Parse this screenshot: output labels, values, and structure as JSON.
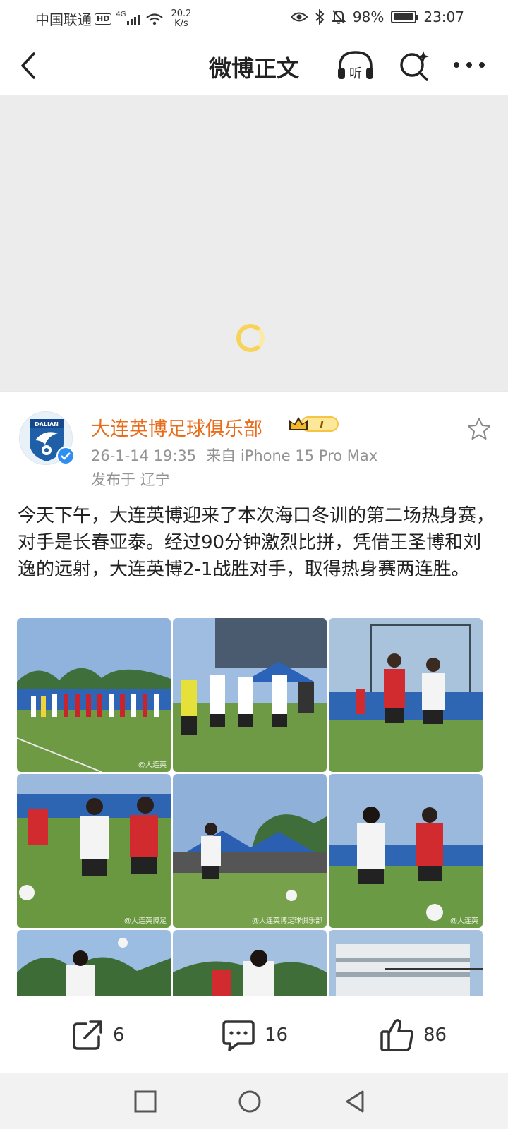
{
  "status_bar": {
    "carrier": "中国联通",
    "hd": "HD",
    "network": "4G",
    "speed_value": "20.2",
    "speed_unit": "K/s",
    "battery": "98%",
    "battery_level": 0.98,
    "time": "23:07"
  },
  "nav": {
    "title": "微博正文",
    "listen_label": "听"
  },
  "post": {
    "author": "大连英博足球俱乐部",
    "avatar_text": "DALIAN",
    "badge_text": "I",
    "date": "26-1-14 19:35",
    "source": "来自 iPhone 15 Pro Max",
    "location": "发布于 辽宁",
    "text": "今天下午，大连英博迎来了本次海口冬训的第二场热身赛，对手是长春亚泰。经过90分钟激烈比拼，凭借王圣博和刘逸的远射，大连英博2-1战胜对手，取得热身赛两连胜。",
    "watermarks": [
      "@大连英",
      "",
      "",
      "@大连英博足",
      "@大连英博足球俱乐部",
      "@大连英"
    ]
  },
  "actions": {
    "share_count": "6",
    "comment_count": "16",
    "like_count": "86"
  },
  "colors": {
    "author": "#e86c1a",
    "meta": "#939393",
    "loading": "#f7d35a",
    "verified": "#2e8ff0"
  }
}
